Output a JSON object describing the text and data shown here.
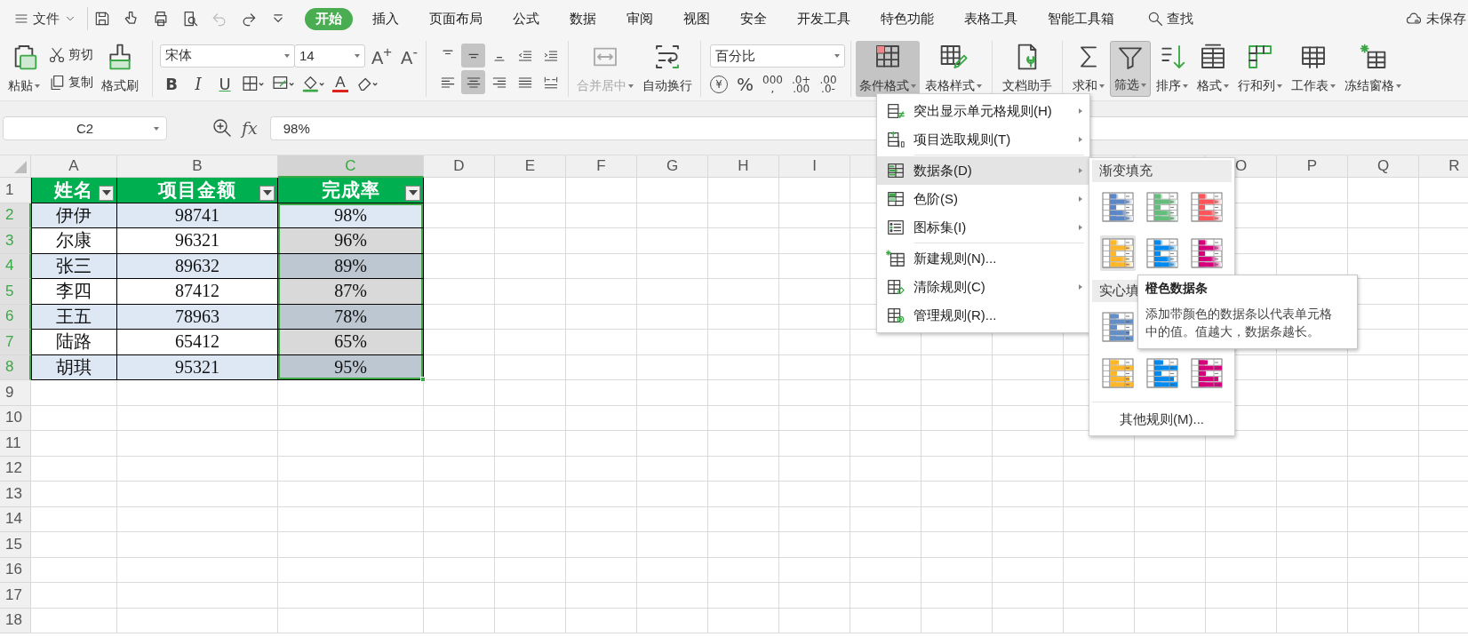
{
  "menu_bar": {
    "file_menu": "文件",
    "tabs": [
      {
        "label": "开始",
        "selected": true
      },
      {
        "label": "插入",
        "selected": false
      },
      {
        "label": "页面布局",
        "selected": false
      },
      {
        "label": "公式",
        "selected": false
      },
      {
        "label": "数据",
        "selected": false
      },
      {
        "label": "审阅",
        "selected": false
      },
      {
        "label": "视图",
        "selected": false
      },
      {
        "label": "安全",
        "selected": false
      },
      {
        "label": "开发工具",
        "selected": false
      },
      {
        "label": "特色功能",
        "selected": false
      },
      {
        "label": "表格工具",
        "selected": false
      },
      {
        "label": "智能工具箱",
        "selected": false
      }
    ],
    "search": "查找",
    "save_status": "未保存"
  },
  "ribbon": {
    "paste": "粘贴",
    "cut": "剪切",
    "copy": "复制",
    "format_painter": "格式刷",
    "font_name": "宋体",
    "font_size": "14",
    "grow_font": "A$^{+}$",
    "shrink_font": "A$^{-}$",
    "font_styles": [
      {
        "label": "B",
        "kind": "bold"
      },
      {
        "label": "I",
        "kind": "italic"
      },
      {
        "label": "U",
        "kind": "underline"
      }
    ],
    "font_color": "A",
    "alignment": [
      {
        "kind": "top",
        "selected": false
      },
      {
        "kind": "middle",
        "selected": true
      },
      {
        "kind": "bottom",
        "selected": false
      },
      {
        "kind": "outdent",
        "selected": false
      },
      {
        "kind": "indent",
        "selected": false
      },
      {
        "kind": "left",
        "selected": false
      },
      {
        "kind": "center",
        "selected": true
      },
      {
        "kind": "right",
        "selected": false
      },
      {
        "kind": "justify",
        "selected": false
      },
      {
        "kind": "distributed",
        "selected": false
      }
    ],
    "merge_center": {
      "label": "合并居中",
      "disabled": true
    },
    "wrap_text": "自动换行",
    "number_format": "百分比",
    "number_buttons": [
      {
        "kind": "currency",
        "lines": [
          "¥"
        ]
      },
      {
        "kind": "percent",
        "lines": [
          "%"
        ]
      },
      {
        "kind": "thousands",
        "lines": [
          "000",
          ","
        ]
      },
      {
        "kind": "add-decimal",
        "lines": [
          ".0+",
          ".00"
        ]
      },
      {
        "kind": "remove-decimal",
        "lines": [
          ".00",
          ".0-"
        ]
      }
    ],
    "tools": [
      {
        "kind": "conditional",
        "label": "条件格式",
        "dropdown": true,
        "pressed": true
      },
      {
        "kind": "table-style",
        "label": "表格样式",
        "dropdown": true,
        "pressed": false
      },
      {
        "kind": "doc-helper",
        "label": "文档助手",
        "dropdown": false,
        "pressed": false
      },
      {
        "kind": "sum",
        "label": "求和",
        "dropdown": true,
        "pressed": false
      },
      {
        "kind": "filter",
        "label": "筛选",
        "dropdown": true,
        "pressed": true
      },
      {
        "kind": "sort",
        "label": "排序",
        "dropdown": true,
        "pressed": false
      },
      {
        "kind": "format",
        "label": "格式",
        "dropdown": true,
        "pressed": false
      },
      {
        "kind": "rows-cols",
        "label": "行和列",
        "dropdown": true,
        "pressed": false
      },
      {
        "kind": "worksheet",
        "label": "工作表",
        "dropdown": true,
        "pressed": false
      },
      {
        "kind": "freeze",
        "label": "冻结窗格",
        "dropdown": true,
        "pressed": false
      }
    ]
  },
  "formula_bar": {
    "cell_ref": "C2",
    "function_label": "fx",
    "formula": "98%"
  },
  "sheet": {
    "columns": [
      {
        "label": "A",
        "selected": false
      },
      {
        "label": "B",
        "selected": false
      },
      {
        "label": "C",
        "selected": true
      },
      {
        "label": "D",
        "selected": false
      },
      {
        "label": "E",
        "selected": false
      },
      {
        "label": "F",
        "selected": false
      },
      {
        "label": "G",
        "selected": false
      },
      {
        "label": "H",
        "selected": false
      },
      {
        "label": "I",
        "selected": false
      },
      {},
      {},
      {},
      {},
      {},
      {
        "label": "O",
        "selected": false
      },
      {
        "label": "P",
        "selected": false
      },
      {
        "label": "Q",
        "selected": false
      },
      {
        "label": "R",
        "selected": false
      }
    ],
    "rows": [
      {
        "number": "1",
        "kind": "header",
        "selected": false,
        "cells": [
          "姓名",
          "项目金额",
          "完成率"
        ]
      },
      {
        "number": "2",
        "kind": "data",
        "selected": true,
        "banded": true,
        "active": true,
        "cells": [
          "伊伊",
          "98741",
          "98%"
        ]
      },
      {
        "number": "3",
        "kind": "data",
        "selected": true,
        "banded": false,
        "active": false,
        "cells": [
          "尔康",
          "96321",
          "96%"
        ]
      },
      {
        "number": "4",
        "kind": "data",
        "selected": true,
        "banded": true,
        "active": false,
        "cells": [
          "张三",
          "89632",
          "89%"
        ]
      },
      {
        "number": "5",
        "kind": "data",
        "selected": true,
        "banded": false,
        "active": false,
        "cells": [
          "李四",
          "87412",
          "87%"
        ]
      },
      {
        "number": "6",
        "kind": "data",
        "selected": true,
        "banded": true,
        "active": false,
        "cells": [
          "王五",
          "78963",
          "78%"
        ]
      },
      {
        "number": "7",
        "kind": "data",
        "selected": true,
        "banded": false,
        "active": false,
        "cells": [
          "陆路",
          "65412",
          "65%"
        ]
      },
      {
        "number": "8",
        "kind": "data",
        "selected": true,
        "banded": true,
        "active": false,
        "cells": [
          "胡琪",
          "95321",
          "95%"
        ]
      },
      {
        "number": "9",
        "kind": "empty",
        "selected": false
      },
      {
        "number": "10",
        "kind": "empty",
        "selected": false
      },
      {
        "number": "11",
        "kind": "empty",
        "selected": false
      },
      {
        "number": "12",
        "kind": "empty",
        "selected": false
      },
      {
        "number": "13",
        "kind": "empty",
        "selected": false
      },
      {
        "number": "14",
        "kind": "empty",
        "selected": false
      },
      {
        "number": "15",
        "kind": "empty",
        "selected": false
      },
      {
        "number": "16",
        "kind": "empty",
        "selected": false
      },
      {
        "number": "17",
        "kind": "empty",
        "selected": false
      },
      {
        "number": "18",
        "kind": "empty",
        "selected": false
      }
    ]
  },
  "conditional_menu": {
    "items": [
      {
        "kind": "highlight",
        "label": "突出显示单元格规则(H)",
        "submenu": true,
        "selected": false,
        "divider_after": false
      },
      {
        "kind": "top-bottom",
        "label": "项目选取规则(T)",
        "submenu": true,
        "selected": false,
        "divider_after": true
      },
      {
        "kind": "data-bar",
        "label": "数据条(D)",
        "submenu": true,
        "selected": true,
        "divider_after": false
      },
      {
        "kind": "color-scale",
        "label": "色阶(S)",
        "submenu": true,
        "selected": false,
        "divider_after": false
      },
      {
        "kind": "icon-set",
        "label": "图标集(I)",
        "submenu": true,
        "selected": false,
        "divider_after": true
      },
      {
        "kind": "new-rule",
        "label": "新建规则(N)...",
        "submenu": false,
        "selected": false,
        "divider_after": false
      },
      {
        "kind": "clear-rule",
        "label": "清除规则(C)",
        "submenu": true,
        "selected": false,
        "divider_after": false
      },
      {
        "kind": "manage-rule",
        "label": "管理规则(R)...",
        "submenu": false,
        "selected": false,
        "divider_after": false
      }
    ]
  },
  "data_bar_menu": {
    "sections": [
      {
        "title": "渐变填充",
        "kind": "gradient",
        "rows": [
          [
            {
              "color": "#5b86c8",
              "selected": false
            },
            {
              "color": "#63be7b",
              "selected": false
            },
            {
              "color": "#ff555a",
              "selected": false
            }
          ],
          [
            {
              "color": "#ffb628",
              "selected": true
            },
            {
              "color": "#008aef",
              "selected": false
            },
            {
              "color": "#d6007b",
              "selected": false
            }
          ]
        ]
      },
      {
        "title": "实心填",
        "kind": "solid",
        "rows": [
          [
            {
              "color": "#638ec6",
              "selected": false
            }
          ],
          [
            {
              "color": "#ffb628",
              "selected": false
            },
            {
              "color": "#008aef",
              "selected": false
            },
            {
              "color": "#d6007b",
              "selected": false
            }
          ]
        ]
      }
    ],
    "footer": "其他规则(M)..."
  },
  "tooltip": {
    "title": "橙色数据条",
    "text": "添加带颜色的数据条以代表单元格中的值。值越大，数据条越长。"
  }
}
